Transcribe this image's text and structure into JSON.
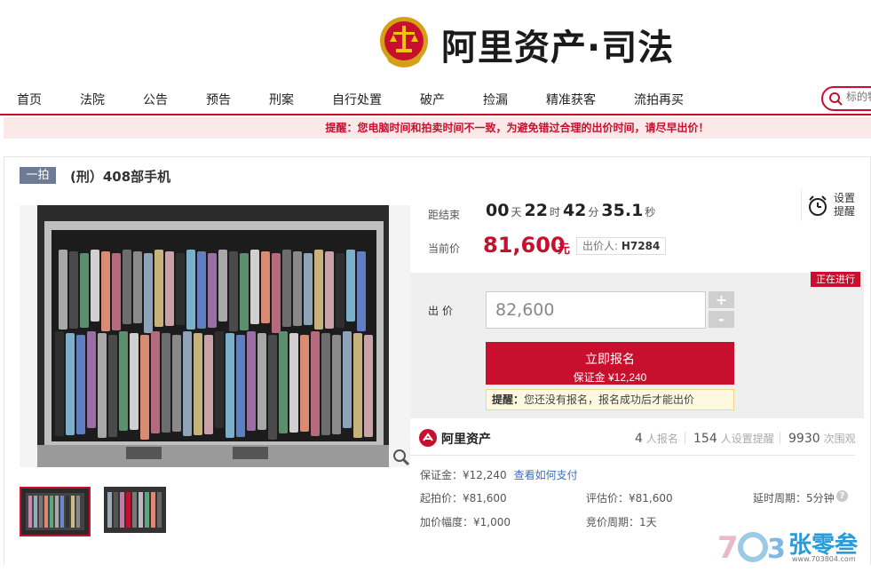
{
  "header": {
    "brand": "阿里资产·司法"
  },
  "nav": {
    "items": [
      "首页",
      "法院",
      "公告",
      "预告",
      "刑案",
      "自行处置",
      "破产",
      "捡漏",
      "精准获客",
      "流拍再买"
    ],
    "search_placeholder": "标的物"
  },
  "notice": "提醒：您电脑时间和拍卖时间不一致，为避免错过合理的出价时间，请尽早出价！",
  "item": {
    "tag": "一拍",
    "title": "(刑）408部手机"
  },
  "countdown": {
    "label": "距结束",
    "days": "00",
    "days_unit": "天",
    "hours": "22",
    "hours_unit": "时",
    "minutes": "42",
    "minutes_unit": "分",
    "seconds": "35.1",
    "seconds_unit": "秒"
  },
  "price": {
    "label": "当前价",
    "value": "81,600",
    "unit": "元",
    "bidder_label": "出价人:",
    "bidder_id": "H7284"
  },
  "reminder": {
    "label": "设置提醒"
  },
  "bid": {
    "status": "正在进行",
    "label": "出价",
    "amount": "82,600",
    "plus": "+",
    "minus": "-",
    "signup_label": "立即报名",
    "deposit_line": "保证金 ¥12,240",
    "tip_prefix": "提醒：",
    "tip_text": "您还没有报名，报名成功后才能出价"
  },
  "platform": {
    "name": "阿里资产",
    "signups_count": "4",
    "signups_label": "人报名",
    "reminders_count": "154",
    "reminders_label": "人设置提醒",
    "views_count": "9930",
    "views_label": "次围观"
  },
  "details": {
    "deposit": "保证金：¥12,240",
    "how_to_pay": "查看如何支付",
    "start_price": "起拍价：¥81,600",
    "appraisal": "评估价：¥81,600",
    "delay": "延时周期：5分钟",
    "increment": "加价幅度：¥1,000",
    "bid_cycle": "竞价周期：1天",
    "help": "?"
  },
  "watermark": {
    "text": "张零叁",
    "url": "www.703804.com"
  },
  "colors": {
    "brand_red": "#c8102e",
    "tag_gray": "#6e7b94",
    "link_blue": "#3a6ec9"
  }
}
